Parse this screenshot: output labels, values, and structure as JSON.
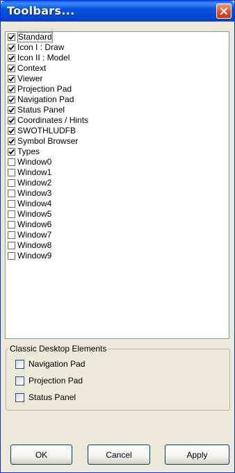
{
  "window": {
    "title": "Toolbars...",
    "title_color": "#ffffff",
    "titlebar_color": "#0855dd",
    "close_color": "#e0502c"
  },
  "toolbar_list": {
    "items": [
      {
        "label": "Standard",
        "checked": true,
        "focused": true
      },
      {
        "label": "Icon I : Draw",
        "checked": true
      },
      {
        "label": "Icon II : Model",
        "checked": true
      },
      {
        "label": "Context",
        "checked": true
      },
      {
        "label": "Viewer",
        "checked": true
      },
      {
        "label": "Projection Pad",
        "checked": true
      },
      {
        "label": "Navigation Pad",
        "checked": true
      },
      {
        "label": "Status Panel",
        "checked": true
      },
      {
        "label": "Coordinates / Hints",
        "checked": true
      },
      {
        "label": "SWOTHLUDFB",
        "checked": true
      },
      {
        "label": "Symbol Browser",
        "checked": true
      },
      {
        "label": "Types",
        "checked": true
      },
      {
        "label": "Window0",
        "checked": false
      },
      {
        "label": "Window1",
        "checked": false
      },
      {
        "label": "Window2",
        "checked": false
      },
      {
        "label": "Window3",
        "checked": false
      },
      {
        "label": "Window4",
        "checked": false
      },
      {
        "label": "Window5",
        "checked": false
      },
      {
        "label": "Window6",
        "checked": false
      },
      {
        "label": "Window7",
        "checked": false
      },
      {
        "label": "Window8",
        "checked": false
      },
      {
        "label": "Window9",
        "checked": false
      }
    ]
  },
  "classic_group": {
    "title": "Classic Desktop Elements",
    "items": [
      {
        "label": "Navigation Pad",
        "checked": false
      },
      {
        "label": "Projection Pad",
        "checked": false
      },
      {
        "label": "Status Panel",
        "checked": false
      }
    ]
  },
  "buttons": {
    "ok": "OK",
    "cancel": "Cancel",
    "apply": "Apply"
  }
}
